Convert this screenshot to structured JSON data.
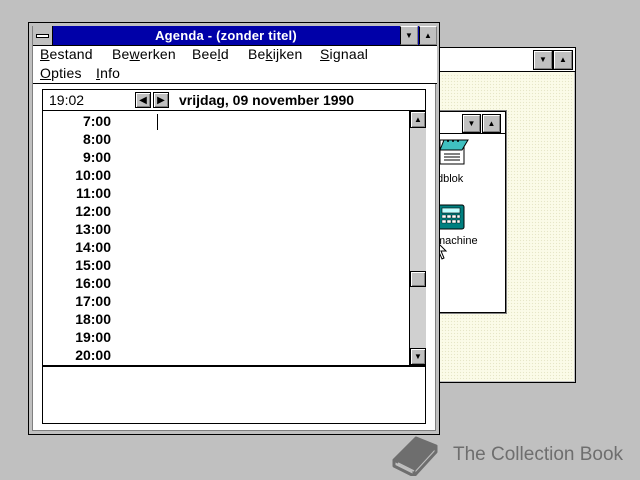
{
  "background_window": {
    "group_items": [
      {
        "label": "dblok",
        "icon": "notepad-icon"
      },
      {
        "label": "machine",
        "icon": "calculator-icon"
      }
    ]
  },
  "agenda": {
    "title": "Agenda - (zonder titel)",
    "menu": [
      {
        "label": "Bestand",
        "mnemonic_index": 0
      },
      {
        "label": "Bewerken",
        "mnemonic_index": 2
      },
      {
        "label": "Beeld",
        "mnemonic_index": 3
      },
      {
        "label": "Bekijken",
        "mnemonic_index": 2
      },
      {
        "label": "Signaal",
        "mnemonic_index": 0
      },
      {
        "label": "Opties",
        "mnemonic_index": 0
      },
      {
        "label": "Info",
        "mnemonic_index": 0
      }
    ],
    "clock": "19:02",
    "date": "vrijdag, 09 november 1990",
    "times": [
      "7:00",
      "8:00",
      "9:00",
      "10:00",
      "11:00",
      "12:00",
      "13:00",
      "14:00",
      "15:00",
      "16:00",
      "17:00",
      "18:00",
      "19:00",
      "20:00"
    ],
    "notes": ""
  },
  "watermark": {
    "text": "The Collection Book",
    "icon": "book-icon"
  },
  "colors": {
    "desktop": "#c0c0c0",
    "active_title": "#0000a8",
    "title_text": "#ffffff",
    "desktop_pattern": "#fbfbe8"
  }
}
